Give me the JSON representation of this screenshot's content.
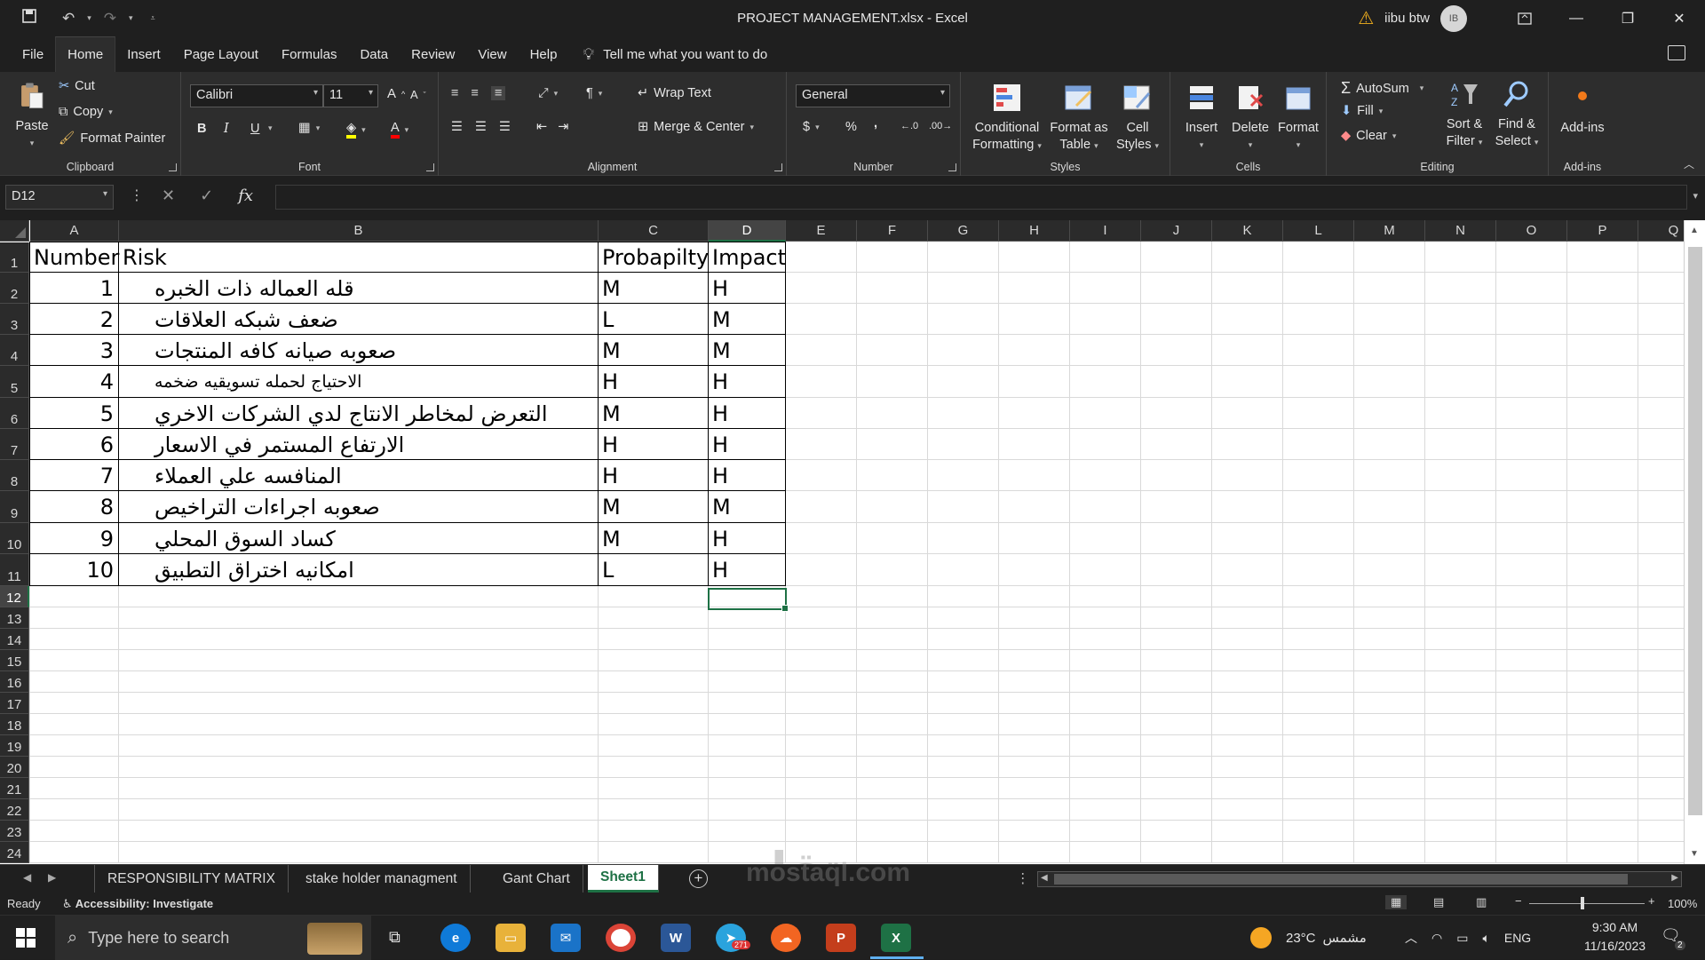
{
  "window": {
    "title": "PROJECT MANAGEMENT.xlsx  -  Excel",
    "user_name": "iibu btw",
    "user_initials": "IB"
  },
  "menu": {
    "tabs": [
      "File",
      "Home",
      "Insert",
      "Page Layout",
      "Formulas",
      "Data",
      "Review",
      "View",
      "Help"
    ],
    "active_tab": "Home",
    "tell_me": "Tell me what you want to do"
  },
  "ribbon": {
    "clipboard": {
      "paste": "Paste",
      "cut": "Cut",
      "copy": "Copy",
      "format_painter": "Format Painter",
      "label": "Clipboard"
    },
    "font": {
      "name": "Calibri",
      "size": "11",
      "label": "Font",
      "bold": "B",
      "italic": "I",
      "underline": "U",
      "grow": "A",
      "shrink": "A"
    },
    "alignment": {
      "wrap_text": "Wrap Text",
      "merge_center": "Merge & Center",
      "label": "Alignment"
    },
    "number": {
      "format": "General",
      "currency": "$",
      "percent": "%",
      "comma": ",",
      "label": "Number"
    },
    "styles": {
      "conditional_1": "Conditional",
      "conditional_2": "Formatting",
      "format_table_1": "Format as",
      "format_table_2": "Table",
      "cell_styles_1": "Cell",
      "cell_styles_2": "Styles",
      "label": "Styles"
    },
    "cells": {
      "insert": "Insert",
      "delete": "Delete",
      "format": "Format",
      "label": "Cells"
    },
    "editing": {
      "autosum": "AutoSum",
      "fill": "Fill",
      "clear": "Clear",
      "sort_1": "Sort &",
      "sort_2": "Filter",
      "find_1": "Find &",
      "find_2": "Select",
      "label": "Editing"
    },
    "addins": {
      "button": "Add-ins",
      "label": "Add-ins"
    }
  },
  "formula_bar": {
    "name_box": "D12",
    "fx": "fx",
    "content": ""
  },
  "columns": [
    "A",
    "B",
    "C",
    "D",
    "E",
    "F",
    "G",
    "H",
    "I",
    "J",
    "K",
    "L",
    "M",
    "N",
    "O",
    "P",
    "Q"
  ],
  "selected_column": "D",
  "rows": [
    "1",
    "2",
    "3",
    "4",
    "5",
    "6",
    "7",
    "8",
    "9",
    "10",
    "11",
    "12",
    "13",
    "14",
    "15",
    "16",
    "17",
    "18",
    "19",
    "20",
    "21",
    "22",
    "23",
    "24"
  ],
  "selected_row": "12",
  "table": {
    "headers": {
      "a": "Number",
      "b": "Risk",
      "c": "Probapilty",
      "d": "Impact"
    },
    "rows": [
      {
        "num": "1",
        "risk": "قله العماله ذات الخبره",
        "prob": "M",
        "impact": "H"
      },
      {
        "num": "2",
        "risk": "ضعف شبكه العلاقات",
        "prob": "L",
        "impact": "M"
      },
      {
        "num": "3",
        "risk": "صعوبه صيانه كافه المنتجات",
        "prob": "M",
        "impact": "M"
      },
      {
        "num": "4",
        "risk": "الاحتياج لحمله تسويقيه ضخمه",
        "prob": "H",
        "impact": "H"
      },
      {
        "num": "5",
        "risk": "التعرض لمخاطر الانتاج لدي الشركات الاخري",
        "prob": "M",
        "impact": "H"
      },
      {
        "num": "6",
        "risk": "الارتفاع المستمر في الاسعار",
        "prob": "H",
        "impact": "H"
      },
      {
        "num": "7",
        "risk": "المنافسه علي العملاء",
        "prob": "H",
        "impact": "H"
      },
      {
        "num": "8",
        "risk": "صعوبه اجراءات التراخيص",
        "prob": "M",
        "impact": "M"
      },
      {
        "num": "9",
        "risk": "كساد السوق المحلي",
        "prob": "M",
        "impact": "H"
      },
      {
        "num": "10",
        "risk": "امكانيه اختراق التطبيق",
        "prob": "L",
        "impact": "H"
      }
    ]
  },
  "sheets": [
    "RESPONSIBILITY MATRIX",
    "stake holder managment",
    "Gant Chart",
    "Sheet1"
  ],
  "active_sheet": "Sheet1",
  "status": {
    "ready": "Ready",
    "accessibility": "Accessibility: Investigate",
    "zoom": "100%"
  },
  "taskbar": {
    "search_placeholder": "Type here to search",
    "telegram_badge": "271",
    "weather_temp": "23°C",
    "weather_text": "مشمس",
    "lang": "ENG",
    "time": "9:30 AM",
    "date": "11/16/2023",
    "notif_count": "2"
  },
  "watermark": {
    "arabic": "مستقل",
    "latin": "mostaql.com"
  },
  "colors": {
    "excel_green": "#1e7145",
    "ribbon_bg": "#2d2d2d",
    "chrome_bg": "#1f1f1f"
  }
}
